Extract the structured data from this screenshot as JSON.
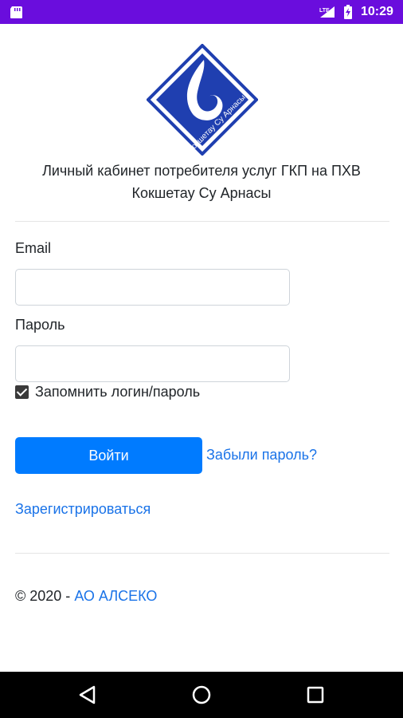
{
  "status_bar": {
    "time": "10:29",
    "network": "LTE",
    "background_color": "#6a0ddd",
    "icons": [
      "notification-icon",
      "lte-signal-icon",
      "battery-icon"
    ]
  },
  "logo": {
    "text": "Кокшетау Су Арнасы",
    "colors": {
      "blue": "#1f3fb0",
      "white": "#ffffff"
    }
  },
  "header": {
    "line1": "Личный кабинет потребителя услуг ГКП на ПХВ",
    "line2": "Кокшетау Су Арнасы"
  },
  "form": {
    "email_label": "Email",
    "email_value": "",
    "password_label": "Пароль",
    "password_value": "",
    "remember_label": "Запомнить логин/пароль",
    "remember_checked": true,
    "login_button": "Войти",
    "forgot_link": "Забыли пароль?",
    "register_link": "Зарегистрироваться"
  },
  "footer": {
    "copyright": "© 2020 - ",
    "company": "АО АЛСЕКО"
  },
  "colors": {
    "primary": "#007bff",
    "link": "#1a73e8",
    "text": "#212529"
  },
  "nav_bar": {
    "icons": [
      "back-icon",
      "home-icon",
      "recents-icon"
    ]
  }
}
